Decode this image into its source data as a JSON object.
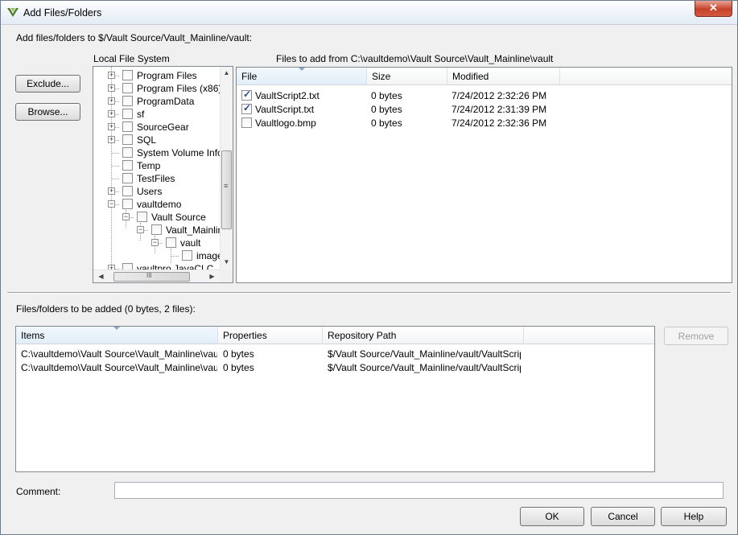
{
  "window": {
    "title": "Add Files/Folders",
    "close_glyph": "✕"
  },
  "header": {
    "add_to_label": "Add files/folders to $/Vault Source/Vault_Mainline/vault:"
  },
  "buttons": {
    "exclude": "Exclude...",
    "browse": "Browse...",
    "remove": "Remove",
    "ok": "OK",
    "cancel": "Cancel",
    "help": "Help"
  },
  "local_fs": {
    "label": "Local File System",
    "items": [
      {
        "label": "Program Files"
      },
      {
        "label": "Program Files (x86)"
      },
      {
        "label": "ProgramData"
      },
      {
        "label": "sf"
      },
      {
        "label": "SourceGear"
      },
      {
        "label": "SQL"
      },
      {
        "label": "System Volume Inform"
      },
      {
        "label": "Temp"
      },
      {
        "label": "TestFiles"
      },
      {
        "label": "Users"
      },
      {
        "label": "vaultdemo"
      },
      {
        "label": "Vault Source"
      },
      {
        "label": "Vault_Mainlin"
      },
      {
        "label": "vault"
      },
      {
        "label": "image"
      },
      {
        "label": "vaultpro JavaCLC"
      }
    ],
    "hscroll_grip": "III",
    "vscroll_grip": "≡"
  },
  "files_panel": {
    "label": "Files to add from C:\\vaultdemo\\Vault Source\\Vault_Mainline\\vault",
    "columns": [
      "File",
      "Size",
      "Modified"
    ],
    "rows": [
      {
        "file": "VaultScript2.txt",
        "size": "0 bytes",
        "modified": "7/24/2012 2:32:26 PM",
        "checked": true
      },
      {
        "file": "VaultScript.txt",
        "size": "0 bytes",
        "modified": "7/24/2012 2:31:39 PM",
        "checked": true
      },
      {
        "file": "Vaultlogo.bmp",
        "size": "0 bytes",
        "modified": "7/24/2012 2:32:36 PM",
        "checked": false
      }
    ]
  },
  "to_add": {
    "label": "Files/folders to be added (0 bytes, 2 files):",
    "columns": [
      "Items",
      "Properties",
      "Repository Path"
    ],
    "rows": [
      {
        "item": "C:\\vaultdemo\\Vault Source\\Vault_Mainline\\vault...",
        "properties": "0 bytes",
        "repo_path": "$/Vault Source/Vault_Mainline/vault/VaultScrip..."
      },
      {
        "item": "C:\\vaultdemo\\Vault Source\\Vault_Mainline\\vault...",
        "properties": "0 bytes",
        "repo_path": "$/Vault Source/Vault_Mainline/vault/VaultScrip..."
      }
    ]
  },
  "comment": {
    "label": "Comment:",
    "value": ""
  },
  "icons": {
    "app": "vault-logo-icon",
    "close": "close-icon",
    "expand": "plus-expander-icon",
    "collapse": "minus-expander-icon",
    "checkbox": "checkbox-icon"
  }
}
